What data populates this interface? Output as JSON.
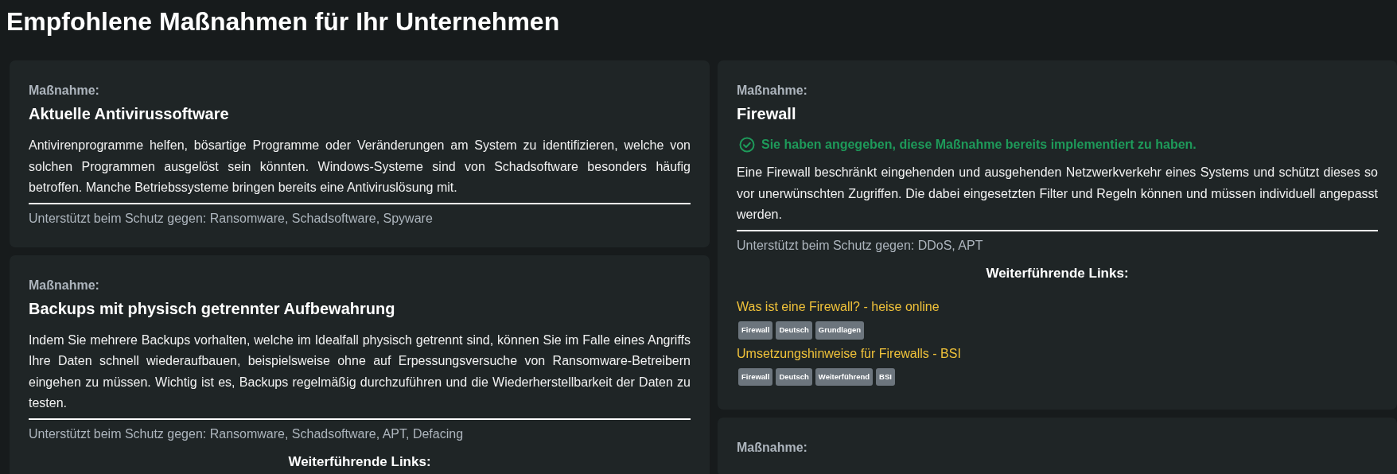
{
  "heading": "Empfohlene Maßnahmen für Ihr Unternehmen",
  "columns": [
    {
      "measures": [
        {
          "label": "Maßnahme:",
          "title": "Aktuelle Antivirussoftware",
          "implemented": false,
          "description": "Antivirenprogramme helfen, bösartige Programme oder Veränderungen am System zu identifizieren, welche von solchen Programmen ausgelöst sein könnten. Windows-Systeme sind von Schadsoftware besonders häufig betroffen. Manche Betriebssysteme bringen bereits eine Antiviruslösung mit.",
          "protects_against": "Unterstützt beim Schutz gegen: Ransomware, Schadsoftware, Spyware"
        },
        {
          "label": "Maßnahme:",
          "title": "Backups mit physisch getrennter Aufbewahrung",
          "implemented": false,
          "description": "Indem Sie mehrere Backups vorhalten, welche im Idealfall physisch getrennt sind, können Sie im Falle eines Angriffs Ihre Daten schnell wiederaufbauen, beispielsweise ohne auf Erpessungsversuche von Ransomware-Betreibern eingehen zu müssen. Wichtig ist es, Backups regelmäßig durchzuführen und die Wiederherstellbarkeit der Daten zu testen.",
          "protects_against": "Unterstützt beim Schutz gegen: Ransomware, Schadsoftware, APT, Defacing",
          "links_heading": "Weiterführende Links:"
        }
      ]
    },
    {
      "measures": [
        {
          "label": "Maßnahme:",
          "title": "Firewall",
          "implemented": true,
          "implemented_note": "Sie haben angegeben, diese Maßnahme bereits implementiert zu haben.",
          "description": "Eine Firewall beschränkt eingehenden und ausgehenden Netzwerkverkehr eines Systems und schützt dieses so vor unerwünschten Zugriffen. Die dabei eingesetzten Filter und Regeln können und müssen individuell angepasst werden.",
          "protects_against": "Unterstützt beim Schutz gegen: DDoS, APT",
          "links_heading": "Weiterführende Links:",
          "links": [
            {
              "text": "Was ist eine Firewall? - heise online",
              "tags": [
                "Firewall",
                "Deutsch",
                "Grundlagen"
              ]
            },
            {
              "text": "Umsetzungshinweise für Firewalls - BSI",
              "tags": [
                "Firewall",
                "Deutsch",
                "Weiterführend",
                "BSI"
              ]
            }
          ]
        },
        {
          "label": "Maßnahme:"
        }
      ]
    }
  ]
}
